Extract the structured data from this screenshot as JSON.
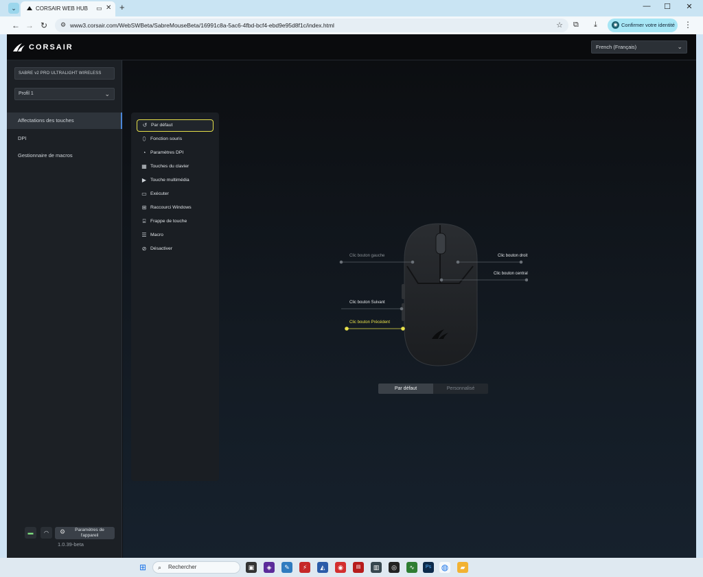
{
  "browser": {
    "tab_title": "CORSAIR WEB HUB",
    "url": "www3.corsair.com/WebSWBeta/SabreMouseBeta/16991c8a-5ac6-4fbd-bcf4-ebd9e95d8f1c/index.html",
    "identity_label": "Confirmer votre identité"
  },
  "app": {
    "brand": "CORSAIR",
    "language": "French (Français)",
    "device_name": "SABRE v2 PRO ULTRALIGHT WIRELESS",
    "profile": "Profil 1",
    "nav": [
      {
        "label": "Affectations des touches",
        "active": true
      },
      {
        "label": "DPI",
        "active": false
      },
      {
        "label": "Gestionnaire de macros",
        "active": false
      }
    ],
    "device_settings": "Paramètres de l'appareil",
    "version": "1.0.39-beta",
    "assignments": [
      {
        "label": "Par défaut",
        "icon": "reset-icon"
      },
      {
        "label": "Fonction souris",
        "icon": "mouse-icon"
      },
      {
        "label": "Paramètres DPI",
        "icon": "dpi-icon"
      },
      {
        "label": "Touches du clavier",
        "icon": "keyboard-icon"
      },
      {
        "label": "Touche multimédia",
        "icon": "media-icon"
      },
      {
        "label": "Exécuter",
        "icon": "launch-icon"
      },
      {
        "label": "Raccourci Windows",
        "icon": "windows-shortcut-icon"
      },
      {
        "label": "Frappe de touche",
        "icon": "keystroke-icon"
      },
      {
        "label": "Macro",
        "icon": "macro-icon"
      },
      {
        "label": "Désactiver",
        "icon": "disable-icon"
      }
    ],
    "mouse_buttons": {
      "left_click": "Clic bouton gauche",
      "right_click": "Clic bouton droit",
      "middle_click": "Clic bouton central",
      "forward": "Clic bouton Suivant",
      "back": "Clic bouton Précédent"
    },
    "mode_toggle": {
      "default": "Par défaut",
      "custom": "Personnalisé"
    }
  },
  "taskbar": {
    "search_placeholder": "Rechercher"
  },
  "colors": {
    "accent_yellow": "#e8e14a",
    "active_nav": "#4a86d8"
  }
}
